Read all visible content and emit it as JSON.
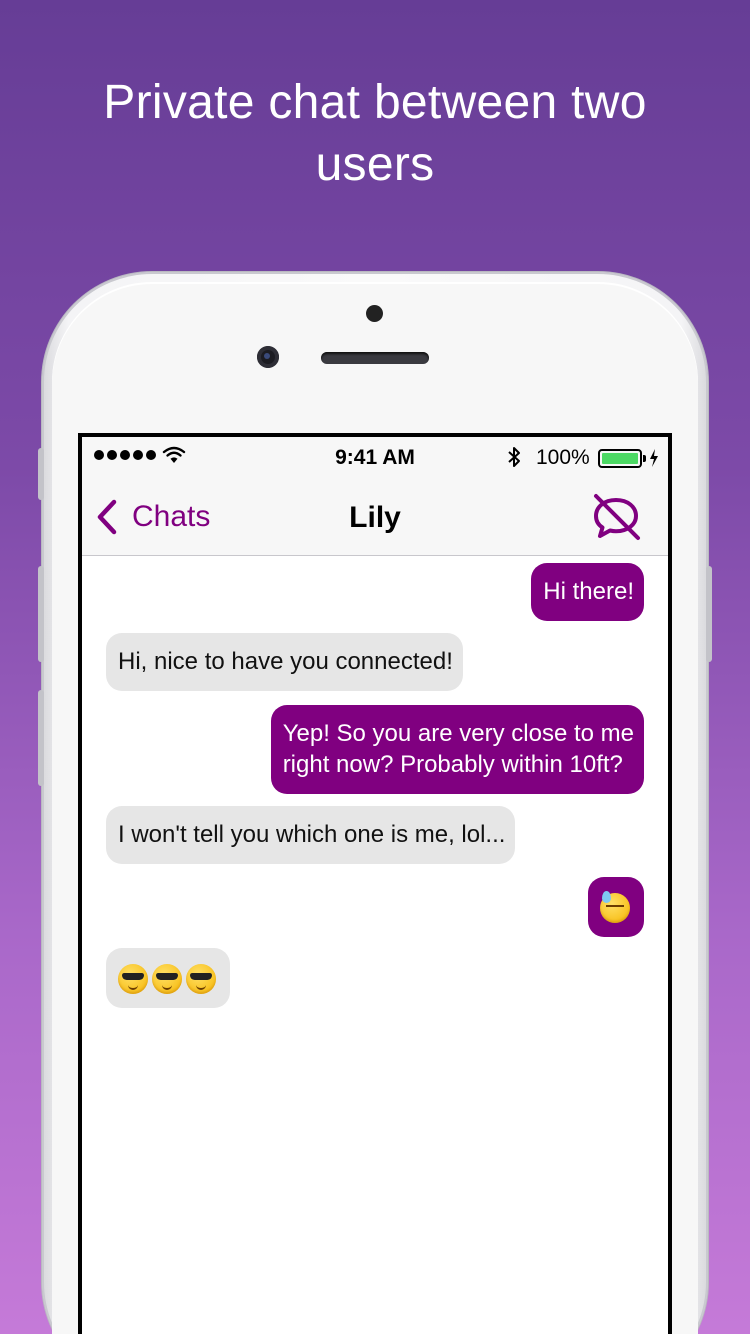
{
  "headline": "Private chat between two\nusers",
  "status_bar": {
    "time": "9:41 AM",
    "battery_percent": "100%",
    "battery_level": 1.0
  },
  "nav": {
    "back_label": "Chats",
    "title": "Lily",
    "back_icon": "chevron-left-icon",
    "action_icon": "chat-off-icon"
  },
  "colors": {
    "accent": "#800080",
    "incoming_bubble": "#e6e6e6",
    "battery_fill": "#4cd964"
  },
  "messages": [
    {
      "direction": "out",
      "text": "Hi there!"
    },
    {
      "direction": "in",
      "text": "Hi, nice to have you connected!"
    },
    {
      "direction": "out",
      "text": "Yep! So you are very close to me\nright now? Probably within 10ft?"
    },
    {
      "direction": "in",
      "text": "I won't tell you which one is me, lol..."
    },
    {
      "direction": "out",
      "emoji": [
        "downcast-face-with-sweat"
      ]
    },
    {
      "direction": "in",
      "emoji": [
        "smiling-face-with-sunglasses",
        "smiling-face-with-sunglasses",
        "smiling-face-with-sunglasses"
      ]
    }
  ]
}
